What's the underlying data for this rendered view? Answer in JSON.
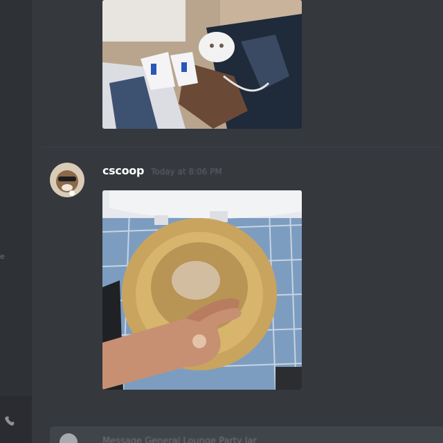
{
  "sidebar": {
    "fragment_text": "e",
    "voice_icon": "phone-icon"
  },
  "message": {
    "author": "cscoop",
    "timestamp": "Today at 8:06 PM",
    "avatar_icon": "user-avatar",
    "attachments": [
      {
        "kind": "image",
        "subject": "person-with-irons-on-bed"
      },
      {
        "kind": "image",
        "subject": "hand-in-toilet-bowl"
      }
    ]
  },
  "composer": {
    "placeholder": "Message General Lounge Party Jar"
  },
  "colors": {
    "background": "#36393f",
    "sidebar": "#2e3136",
    "username": "#ffffff",
    "timestamp": "#5f6369",
    "composer": "#40444b"
  }
}
